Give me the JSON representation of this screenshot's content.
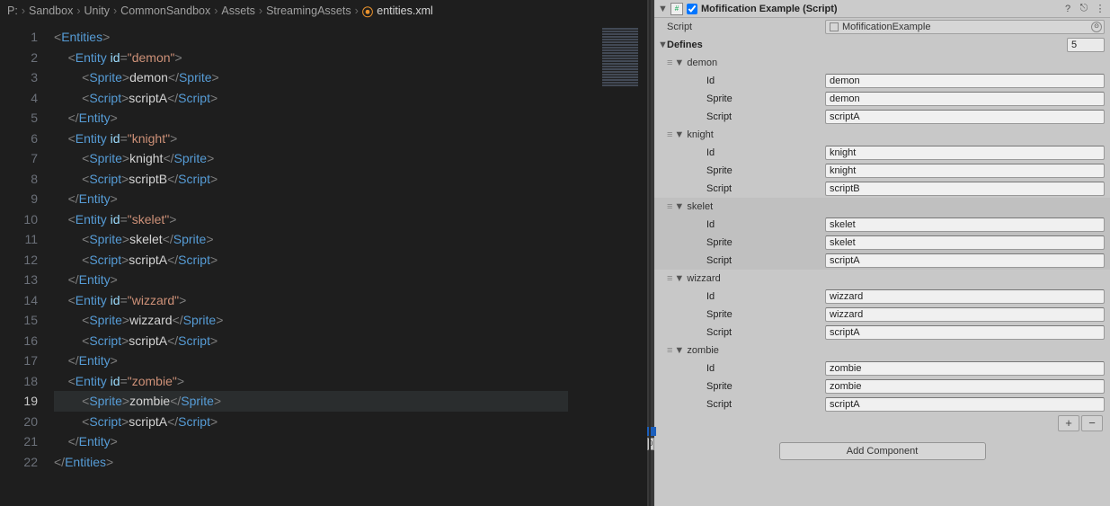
{
  "breadcrumb": [
    "P:",
    "Sandbox",
    "Unity",
    "CommonSandbox",
    "Assets",
    "StreamingAssets"
  ],
  "file": "entities.xml",
  "current_line": 19,
  "code_lines": [
    {
      "n": 1,
      "i": 0,
      "type": "open",
      "tag": "Entities"
    },
    {
      "n": 2,
      "i": 1,
      "type": "open",
      "tag": "Entity",
      "attr": "id",
      "val": "demon"
    },
    {
      "n": 3,
      "i": 2,
      "type": "elem",
      "tag": "Sprite",
      "text": "demon"
    },
    {
      "n": 4,
      "i": 2,
      "type": "elem",
      "tag": "Script",
      "text": "scriptA"
    },
    {
      "n": 5,
      "i": 1,
      "type": "close",
      "tag": "Entity"
    },
    {
      "n": 6,
      "i": 1,
      "type": "open",
      "tag": "Entity",
      "attr": "id",
      "val": "knight"
    },
    {
      "n": 7,
      "i": 2,
      "type": "elem",
      "tag": "Sprite",
      "text": "knight"
    },
    {
      "n": 8,
      "i": 2,
      "type": "elem",
      "tag": "Script",
      "text": "scriptB"
    },
    {
      "n": 9,
      "i": 1,
      "type": "close",
      "tag": "Entity"
    },
    {
      "n": 10,
      "i": 1,
      "type": "open",
      "tag": "Entity",
      "attr": "id",
      "val": "skelet"
    },
    {
      "n": 11,
      "i": 2,
      "type": "elem",
      "tag": "Sprite",
      "text": "skelet"
    },
    {
      "n": 12,
      "i": 2,
      "type": "elem",
      "tag": "Script",
      "text": "scriptA"
    },
    {
      "n": 13,
      "i": 1,
      "type": "close",
      "tag": "Entity"
    },
    {
      "n": 14,
      "i": 1,
      "type": "open",
      "tag": "Entity",
      "attr": "id",
      "val": "wizzard"
    },
    {
      "n": 15,
      "i": 2,
      "type": "elem",
      "tag": "Sprite",
      "text": "wizzard"
    },
    {
      "n": 16,
      "i": 2,
      "type": "elem",
      "tag": "Script",
      "text": "scriptA"
    },
    {
      "n": 17,
      "i": 1,
      "type": "close",
      "tag": "Entity"
    },
    {
      "n": 18,
      "i": 1,
      "type": "open",
      "tag": "Entity",
      "attr": "id",
      "val": "zombie"
    },
    {
      "n": 19,
      "i": 2,
      "type": "elem",
      "tag": "Sprite",
      "text": "zombie"
    },
    {
      "n": 20,
      "i": 2,
      "type": "elem",
      "tag": "Script",
      "text": "scriptA"
    },
    {
      "n": 21,
      "i": 1,
      "type": "close",
      "tag": "Entity"
    },
    {
      "n": 22,
      "i": 0,
      "type": "close",
      "tag": "Entities"
    }
  ],
  "inspector": {
    "component_title": "Mofification Example (Script)",
    "enabled": true,
    "script_label": "Script",
    "script_value": "MofificationExample",
    "defines_label": "Defines",
    "defines_count": "5",
    "field_labels": {
      "id": "Id",
      "sprite": "Sprite",
      "script": "Script"
    },
    "elements": [
      {
        "name": "demon",
        "id": "demon",
        "sprite": "demon",
        "script": "scriptA",
        "stripe": false
      },
      {
        "name": "knight",
        "id": "knight",
        "sprite": "knight",
        "script": "scriptB",
        "stripe": false
      },
      {
        "name": "skelet",
        "id": "skelet",
        "sprite": "skelet",
        "script": "scriptA",
        "stripe": true
      },
      {
        "name": "wizzard",
        "id": "wizzard",
        "sprite": "wizzard",
        "script": "scriptA",
        "stripe": false
      },
      {
        "name": "zombie",
        "id": "zombie",
        "sprite": "zombie",
        "script": "scriptA",
        "stripe": false
      }
    ],
    "add_component_label": "Add Component",
    "badge_zero": "0"
  }
}
